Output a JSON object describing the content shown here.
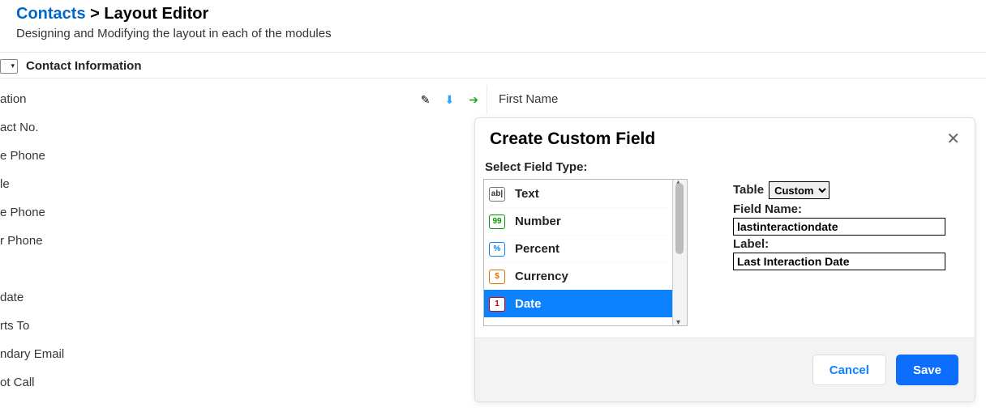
{
  "breadcrumb": {
    "link": "Contacts",
    "sep": ">",
    "current": "Layout Editor"
  },
  "subheading": "Designing and Modifying the layout in each of the modules",
  "section": {
    "title": "Contact Information",
    "toggle_glyph": "▾"
  },
  "left_fields": [
    "ation",
    "act No.",
    "e Phone",
    "le",
    "e Phone",
    "r Phone",
    "",
    "date",
    "rts To",
    "ndary Email",
    "ot Call"
  ],
  "right_field": "First Name",
  "action_icons": {
    "edit": "✎",
    "down": "⬇",
    "right": "➔"
  },
  "modal": {
    "title": "Create Custom Field",
    "close_glyph": "✕",
    "select_label": "Select Field Type:",
    "field_types": [
      {
        "icon_text": "ab|",
        "label": "Text",
        "icon_color": "#333",
        "selected": false
      },
      {
        "icon_text": "99",
        "label": "Number",
        "icon_color": "#009900",
        "selected": false
      },
      {
        "icon_text": "%",
        "label": "Percent",
        "icon_color": "#0d82ff",
        "selected": false
      },
      {
        "icon_text": "$",
        "label": "Currency",
        "icon_color": "#e07000",
        "selected": false
      },
      {
        "icon_text": "1",
        "label": "Date",
        "icon_color": "#cc0000",
        "selected": true
      }
    ],
    "scroll_up": "▴",
    "scroll_down": "▾",
    "form": {
      "table_label": "Table",
      "table_value": "Custom",
      "fieldname_label": "Field Name:",
      "fieldname_value": "lastinteractiondate",
      "label_label": "Label:",
      "label_value": "Last Interaction Date"
    },
    "buttons": {
      "cancel": "Cancel",
      "save": "Save"
    }
  }
}
